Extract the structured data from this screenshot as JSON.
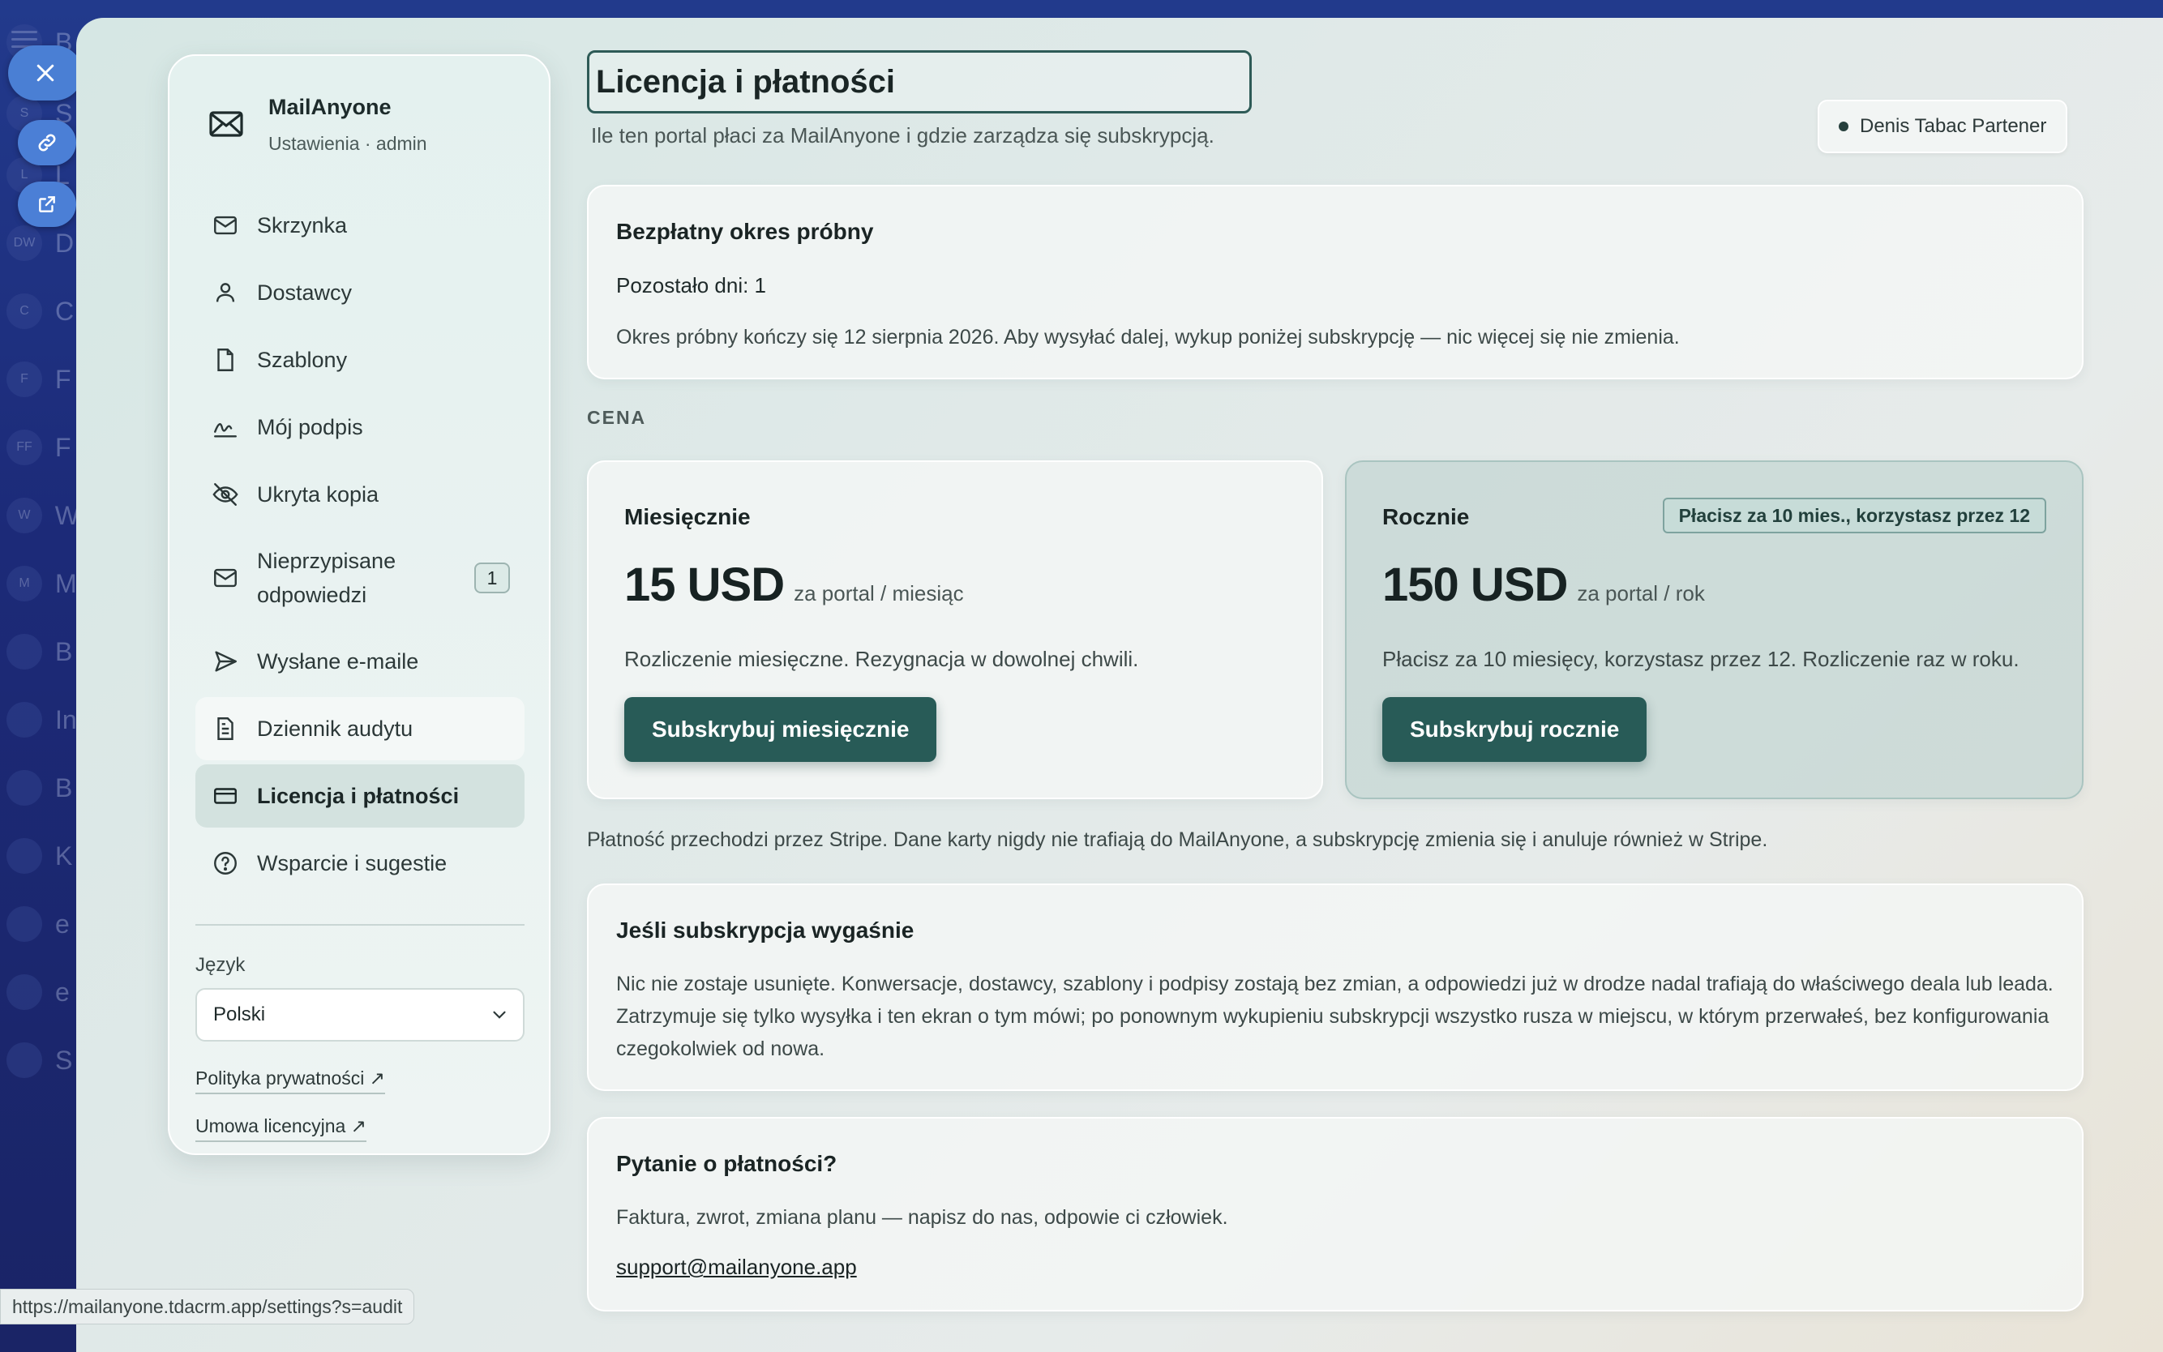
{
  "app": {
    "brand_name": "MailAnyone",
    "brand_sub": "Ustawienia · admin"
  },
  "background_list": [
    {
      "avatar": "",
      "letter": "B"
    },
    {
      "avatar": "S",
      "letter": "S"
    },
    {
      "avatar": "L",
      "letter": "L"
    },
    {
      "avatar": "DW",
      "letter": "D"
    },
    {
      "avatar": "C",
      "letter": "C"
    },
    {
      "avatar": "F",
      "letter": "F"
    },
    {
      "avatar": "FF",
      "letter": "F"
    },
    {
      "avatar": "W",
      "letter": "W"
    },
    {
      "avatar": "M",
      "letter": "M"
    },
    {
      "avatar": "",
      "letter": "B"
    },
    {
      "avatar": "",
      "letter": "In"
    },
    {
      "avatar": "",
      "letter": "B"
    },
    {
      "avatar": "",
      "letter": "K"
    },
    {
      "avatar": "",
      "letter": "e"
    },
    {
      "avatar": "",
      "letter": "e"
    },
    {
      "avatar": "",
      "letter": "S"
    }
  ],
  "nav": {
    "items": [
      {
        "label": "Skrzynka",
        "icon": "mail-icon"
      },
      {
        "label": "Dostawcy",
        "icon": "user-icon"
      },
      {
        "label": "Szablony",
        "icon": "file-icon"
      },
      {
        "label": "Mój podpis",
        "icon": "signature-icon"
      },
      {
        "label": "Ukryta kopia",
        "icon": "eye-off-icon"
      },
      {
        "label": "Nieprzypisane odpowiedzi",
        "icon": "mail-icon",
        "badge": "1"
      },
      {
        "label": "Wysłane e-maile",
        "icon": "send-icon"
      },
      {
        "label": "Dziennik audytu",
        "icon": "document-icon"
      },
      {
        "label": "Licencja i płatności",
        "icon": "card-icon"
      },
      {
        "label": "Wsparcie i sugestie",
        "icon": "help-icon"
      }
    ]
  },
  "language": {
    "label": "Język",
    "value": "Polski"
  },
  "footer_links": {
    "privacy": "Polityka prywatności ↗",
    "license": "Umowa licencyjna ↗"
  },
  "header": {
    "title": "Licencja i płatności",
    "subtitle": "Ile ten portal płaci za MailAnyone i gdzie zarządza się subskrypcją.",
    "user": "Denis Tabac Partener"
  },
  "trial": {
    "title": "Bezpłatny okres próbny",
    "remaining": "Pozostało dni: 1",
    "note": "Okres próbny kończy się 12 sierpnia 2026. Aby wysyłać dalej, wykup poniżej subskrypcję — nic więcej się nie zmienia."
  },
  "pricing": {
    "section_label": "CENA",
    "monthly": {
      "name": "Miesięcznie",
      "amount": "15 USD",
      "unit": "za portal / miesiąc",
      "description": "Rozliczenie miesięczne. Rezygnacja w dowolnej chwili.",
      "button": "Subskrybuj miesięcznie"
    },
    "yearly": {
      "name": "Rocznie",
      "tag": "Płacisz za 10 mies., korzystasz przez 12",
      "amount": "150 USD",
      "unit": "za portal / rok",
      "description": "Płacisz za 10 miesięcy, korzystasz przez 12. Rozliczenie raz w roku.",
      "button": "Subskrybuj rocznie"
    },
    "stripe_note": "Płatność przechodzi przez Stripe. Dane karty nigdy nie trafiają do MailAnyone, a subskrypcję zmienia się i anuluje również w Stripe."
  },
  "expiry": {
    "title": "Jeśli subskrypcja wygaśnie",
    "body": "Nic nie zostaje usunięte. Konwersacje, dostawcy, szablony i podpisy zostają bez zmian, a odpowiedzi już w drodze nadal trafiają do właściwego deala lub leada. Zatrzymuje się tylko wysyłka i ten ekran o tym mówi; po ponownym wykupieniu subskrypcji wszystko rusza w miejscu, w którym przerwałeś, bez konfigurowania czegokolwiek od nowa."
  },
  "questions": {
    "title": "Pytanie o płatności?",
    "body": "Faktura, zwrot, zmiana planu — napisz do nas, odpowie ci człowiek.",
    "email": "support@mailanyone.app"
  },
  "status_bar": {
    "url": "https://mailanyone.tdacrm.app/settings?s=audit"
  },
  "colors": {
    "accent": "#285b57",
    "active_nav": "#d3e2df",
    "background": "#1e2a6e"
  }
}
